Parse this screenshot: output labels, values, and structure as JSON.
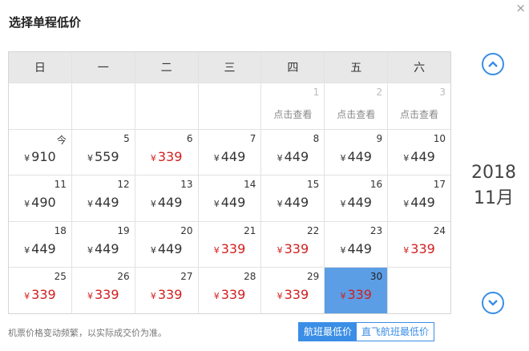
{
  "dialog": {
    "title": "选择单程低价",
    "close_glyph": "×"
  },
  "weekdays": [
    "日",
    "一",
    "二",
    "三",
    "四",
    "五",
    "六"
  ],
  "lookup_label": "点击查看",
  "currency": "¥",
  "past_days": [
    {
      "day": "1",
      "lookup": "点击查看"
    },
    {
      "day": "2",
      "lookup": "点击查看"
    },
    {
      "day": "3",
      "lookup": "点击查看"
    }
  ],
  "weeks": [
    [
      {
        "day": "今",
        "price": "910",
        "low": false
      },
      {
        "day": "5",
        "price": "559",
        "low": false
      },
      {
        "day": "6",
        "price": "339",
        "low": true
      },
      {
        "day": "7",
        "price": "449",
        "low": false
      },
      {
        "day": "8",
        "price": "449",
        "low": false
      },
      {
        "day": "9",
        "price": "449",
        "low": false
      },
      {
        "day": "10",
        "price": "449",
        "low": false
      }
    ],
    [
      {
        "day": "11",
        "price": "490",
        "low": false
      },
      {
        "day": "12",
        "price": "449",
        "low": false
      },
      {
        "day": "13",
        "price": "449",
        "low": false
      },
      {
        "day": "14",
        "price": "449",
        "low": false
      },
      {
        "day": "15",
        "price": "449",
        "low": false
      },
      {
        "day": "16",
        "price": "449",
        "low": false
      },
      {
        "day": "17",
        "price": "449",
        "low": false
      }
    ],
    [
      {
        "day": "18",
        "price": "449",
        "low": false
      },
      {
        "day": "19",
        "price": "449",
        "low": false
      },
      {
        "day": "20",
        "price": "449",
        "low": false
      },
      {
        "day": "21",
        "price": "339",
        "low": true
      },
      {
        "day": "22",
        "price": "339",
        "low": true
      },
      {
        "day": "23",
        "price": "449",
        "low": false
      },
      {
        "day": "24",
        "price": "339",
        "low": true
      }
    ],
    [
      {
        "day": "25",
        "price": "339",
        "low": true
      },
      {
        "day": "26",
        "price": "339",
        "low": true
      },
      {
        "day": "27",
        "price": "339",
        "low": true
      },
      {
        "day": "28",
        "price": "339",
        "low": true
      },
      {
        "day": "29",
        "price": "339",
        "low": true
      },
      {
        "day": "30",
        "price": "339",
        "low": true,
        "selected": true
      }
    ]
  ],
  "month_nav": {
    "year": "2018",
    "month": "11月"
  },
  "footer": {
    "note": "机票价格变动频繁，以实际成交价为准。",
    "toggle_lowest": "航班最低价",
    "toggle_direct": "直飞航班最低价"
  },
  "colors": {
    "accent": "#3a8ee6",
    "low_price": "#d21e1e",
    "selected_bg": "#5b9ee5"
  }
}
